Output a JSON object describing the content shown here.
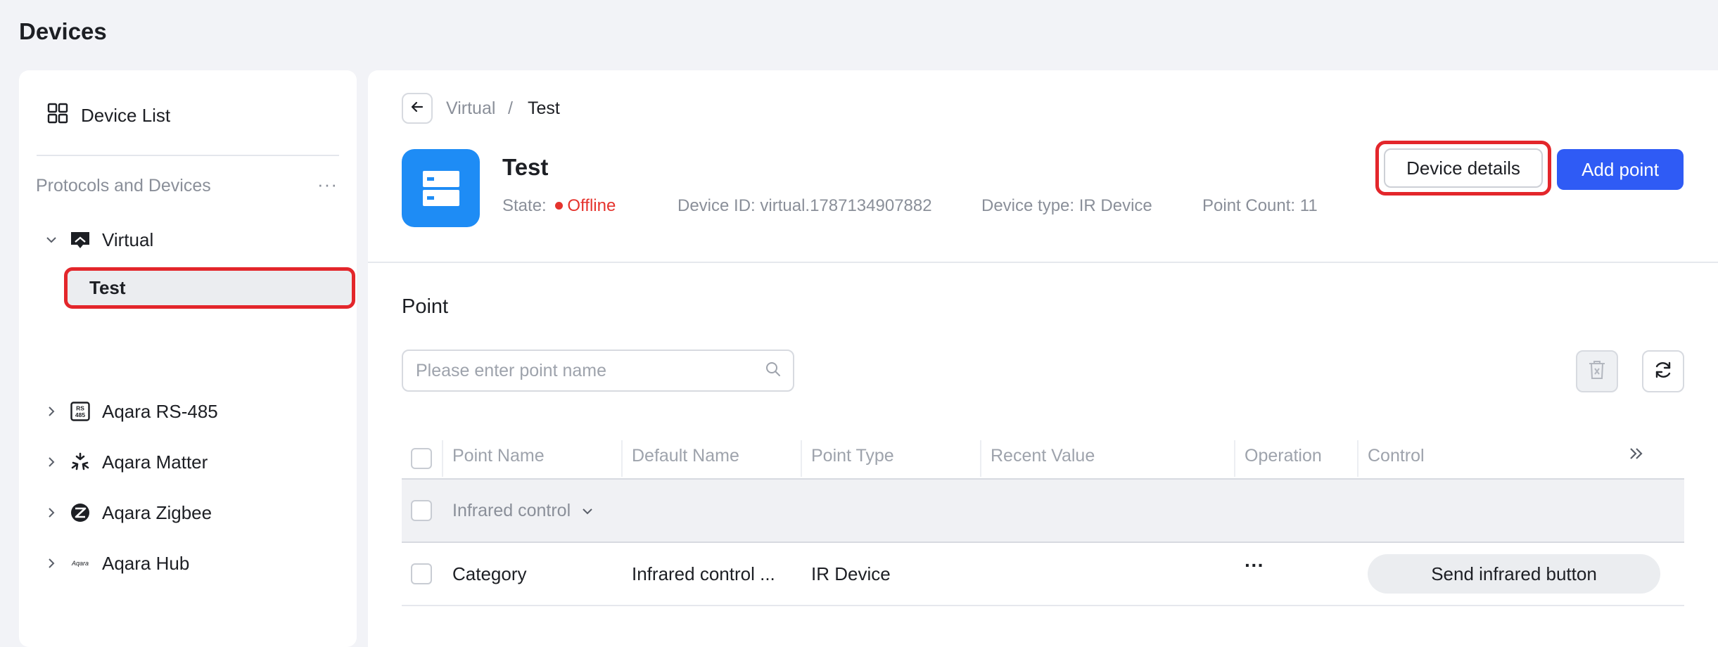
{
  "page": {
    "title": "Devices"
  },
  "sidebar": {
    "device_list_label": "Device List",
    "section_title": "Protocols and Devices",
    "more_label": "···",
    "tree": [
      {
        "label": "Virtual",
        "icon": "virtual-icon",
        "expanded": true
      },
      {
        "label": "Aqara RS-485",
        "icon": "rs485-icon",
        "expanded": false
      },
      {
        "label": "Aqara Matter",
        "icon": "matter-icon",
        "expanded": false
      },
      {
        "label": "Aqara Zigbee",
        "icon": "zigbee-icon",
        "expanded": false
      },
      {
        "label": "Aqara Hub",
        "icon": "aqara-hub-icon",
        "expanded": false
      }
    ],
    "selected_child": "Test",
    "rs485_icon_text": "RS 485",
    "hub_icon_text": "Aqara"
  },
  "breadcrumb": {
    "parent": "Virtual",
    "separator": "/",
    "current": "Test"
  },
  "device": {
    "name": "Test",
    "state_label": "State:",
    "state_value": "Offline",
    "id_label": "Device ID:",
    "id_value": "virtual.1787134907882",
    "type_label": "Device type:",
    "type_value": "IR Device",
    "count_label": "Point Count:",
    "count_value": "11"
  },
  "actions": {
    "details_label": "Device details",
    "add_label": "Add point"
  },
  "point": {
    "section_title": "Point",
    "search_placeholder": "Please enter point name",
    "columns": [
      "Point Name",
      "Default Name",
      "Point Type",
      "Recent Value",
      "Operation",
      "Control"
    ],
    "group_label": "Infrared control",
    "rows": [
      {
        "point_name": "Category",
        "default_name": "Infrared control ...",
        "point_type": "IR Device",
        "recent_value": "",
        "operation": "···",
        "control_label": "Send infrared button"
      }
    ]
  },
  "colors": {
    "accent": "#2f5bf5",
    "offline": "#e5332d",
    "highlight": "#e3262b",
    "device_icon_bg": "#1e8cf5"
  }
}
